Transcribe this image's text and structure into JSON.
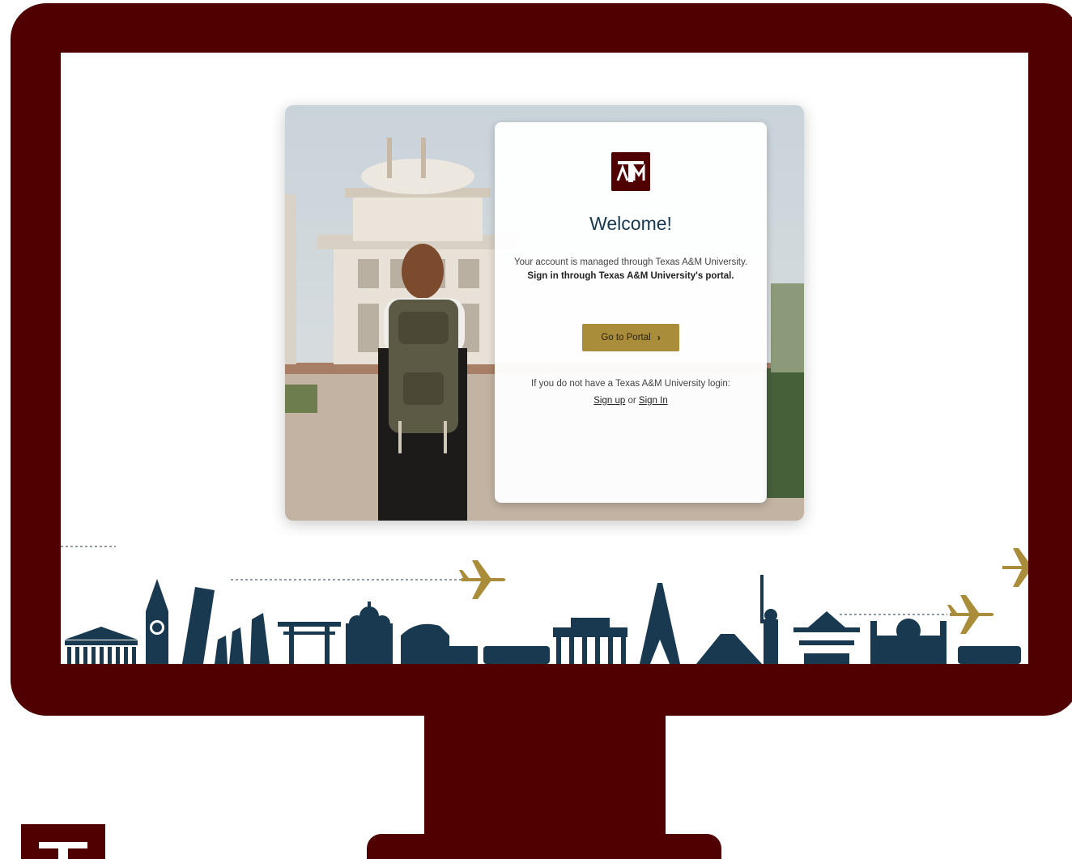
{
  "login": {
    "title": "Welcome!",
    "message_prefix": "Your account is managed through Texas A&M University. ",
    "message_bold": "Sign in through Texas A&M University's portal.",
    "portal_button": "Go to Portal",
    "alt_prompt": "If you do not have a Texas A&M University login:",
    "signup_link": "Sign up",
    "link_separator": " or ",
    "signin_link": "Sign In"
  },
  "logo": {
    "text": "ATM"
  },
  "colors": {
    "maroon": "#500000",
    "gold": "#a98d3a",
    "navy": "#18394f",
    "airplane": "#a98d3a"
  },
  "icons": [
    "atm-logo-icon",
    "chevron-right-icon",
    "airplane-icon"
  ]
}
